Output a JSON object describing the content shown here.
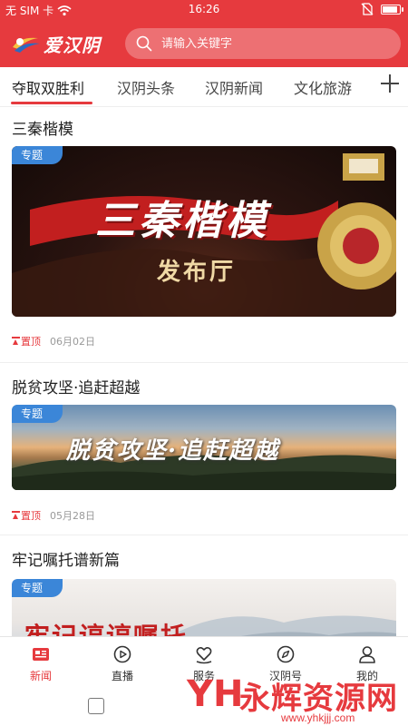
{
  "status_bar": {
    "carrier": "无 SIM 卡",
    "time": "16:26"
  },
  "header": {
    "logo_text": "爱汉阴",
    "search_placeholder": "请输入关键字",
    "accent_color": "#e63a3e"
  },
  "tabs": [
    {
      "label": "夺取双胜利",
      "active": true
    },
    {
      "label": "汉阴头条",
      "active": false
    },
    {
      "label": "汉阴新闻",
      "active": false
    },
    {
      "label": "文化旅游",
      "active": false
    }
  ],
  "feed": [
    {
      "title": "三秦楷模",
      "badge": "专题",
      "image_title": "三秦楷模",
      "image_subtitle": "发布厅",
      "pinned_label": "置顶",
      "date": "06月02日"
    },
    {
      "title": "脱贫攻坚·追赶超越",
      "badge": "专题",
      "image_title": "脱贫攻坚·追赶超越",
      "pinned_label": "置顶",
      "date": "05月28日"
    },
    {
      "title": "牢记嘱托谱新篇",
      "badge": "专题",
      "image_title": "牢记谆谆嘱托"
    }
  ],
  "bottom_nav": [
    {
      "label": "新闻",
      "icon": "news-icon",
      "active": true
    },
    {
      "label": "直播",
      "icon": "live-play-icon",
      "active": false
    },
    {
      "label": "服务",
      "icon": "service-heart-icon",
      "active": false
    },
    {
      "label": "汉阴号",
      "icon": "compass-icon",
      "active": false
    },
    {
      "label": "我的",
      "icon": "user-icon",
      "active": false
    }
  ],
  "watermark": {
    "logo": "YH",
    "text": "永辉资源网",
    "url": "www.yhkjjj.com"
  }
}
